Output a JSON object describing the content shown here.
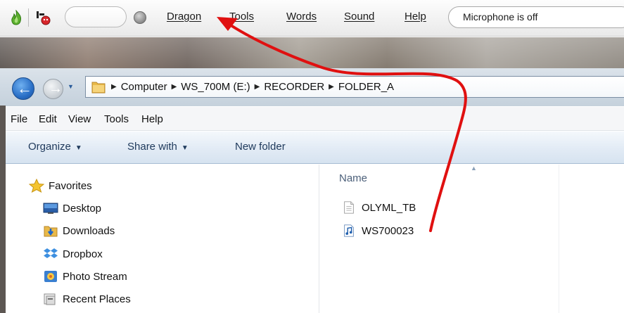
{
  "dragon": {
    "menus": [
      "Dragon",
      "Tools",
      "Words",
      "Sound",
      "Help"
    ],
    "status": "Microphone is off"
  },
  "explorer": {
    "breadcrumbs": [
      "Computer",
      "WS_700M (E:)",
      "RECORDER",
      "FOLDER_A"
    ],
    "menu": [
      "File",
      "Edit",
      "View",
      "Tools",
      "Help"
    ],
    "commands": {
      "organize": "Organize",
      "share_with": "Share with",
      "new_folder": "New folder"
    },
    "nav_pane": {
      "favorites": "Favorites",
      "items": [
        "Desktop",
        "Downloads",
        "Dropbox",
        "Photo Stream",
        "Recent Places"
      ]
    },
    "file_list": {
      "column_name": "Name",
      "files": [
        "OLYML_TB",
        "WS700023"
      ]
    }
  },
  "colors": {
    "annotation_arrow": "#e01010",
    "command_text": "#1e395b"
  }
}
